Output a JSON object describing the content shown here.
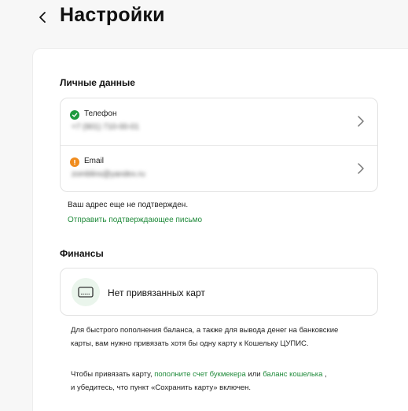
{
  "header": {
    "title": "Настройки"
  },
  "personal": {
    "section_title": "Личные данные",
    "phone": {
      "label": "Телефон",
      "value": "+7 (901) 710-00-01",
      "status_color": "#1f9a3e"
    },
    "email": {
      "label": "Email",
      "value": "zomblins@yandex.ru",
      "status_color": "#f08c1e"
    },
    "unverified_note": "Ваш адрес еще не подтвержден.",
    "send_link": "Отправить подтверждающее письмо"
  },
  "finance": {
    "section_title": "Финансы",
    "no_cards": "Нет привязанных карт",
    "info_text": "Для быстрого пополнения баланса, а также для вывода денег на банковские карты, вам нужно привязать хотя бы одну карту к Кошельку ЦУПИС.",
    "bind_prefix": "Чтобы привязать карту, ",
    "bind_link1": "пополните счет букмекера",
    "bind_or": " или ",
    "bind_link2": "баланс кошелька",
    "bind_suffix": " ,",
    "bind_line2": "и убедитесь, что пункт «Сохранить карту» включен."
  },
  "colors": {
    "accent": "#1f8a3a"
  }
}
